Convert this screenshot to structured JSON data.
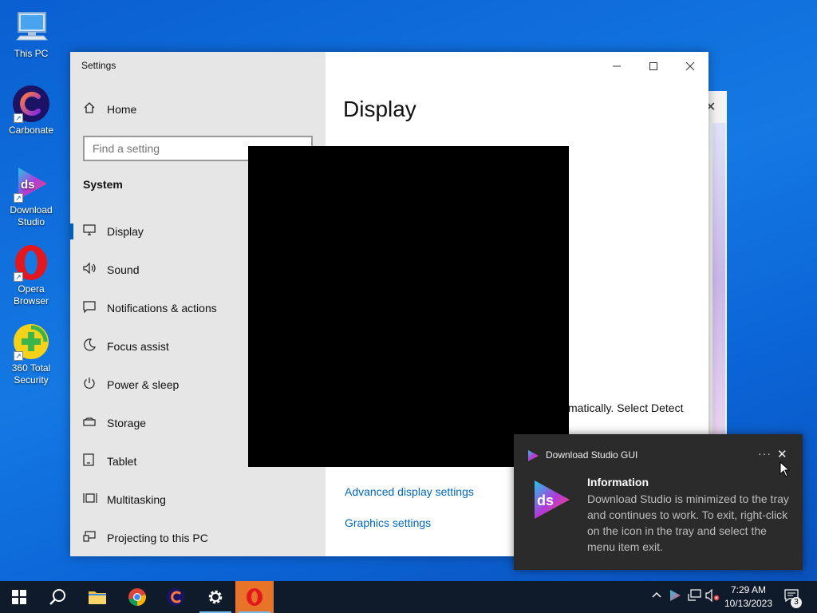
{
  "desktop": {
    "icons": [
      {
        "label": "This PC"
      },
      {
        "label": "Carbonate"
      },
      {
        "label": "Download Studio"
      },
      {
        "label": "Opera Browser"
      },
      {
        "label": "360 Total Security"
      }
    ]
  },
  "settings": {
    "window_title": "Settings",
    "home_label": "Home",
    "search_placeholder": "Find a setting",
    "section": "System",
    "nav_items": [
      {
        "label": "Display",
        "icon": "monitor-icon",
        "active": true
      },
      {
        "label": "Sound",
        "icon": "speaker-icon"
      },
      {
        "label": "Notifications & actions",
        "icon": "message-icon"
      },
      {
        "label": "Focus assist",
        "icon": "moon-icon"
      },
      {
        "label": "Power & sleep",
        "icon": "power-icon"
      },
      {
        "label": "Storage",
        "icon": "storage-icon"
      },
      {
        "label": "Tablet",
        "icon": "tablet-icon"
      },
      {
        "label": "Multitasking",
        "icon": "multitasking-icon"
      },
      {
        "label": "Projecting to this PC",
        "icon": "projector-icon"
      }
    ],
    "content": {
      "title": "Display",
      "partial_text": "matically. Select Detect",
      "links": [
        "Advanced display settings",
        "Graphics settings"
      ]
    }
  },
  "toast": {
    "app_name": "Download Studio GUI",
    "heading": "Information",
    "body": "Download Studio is minimized to the tray and continues to work. To exit, right-click on the icon in the tray and select the menu item exit."
  },
  "taskbar": {
    "time": "7:29 AM",
    "date": "10/13/2023",
    "notification_count": "3"
  },
  "colors": {
    "accent": "#0063b1",
    "link": "#0067c0",
    "taskbar": "#0f1a2b",
    "toast_bg": "#2b2b2b"
  }
}
